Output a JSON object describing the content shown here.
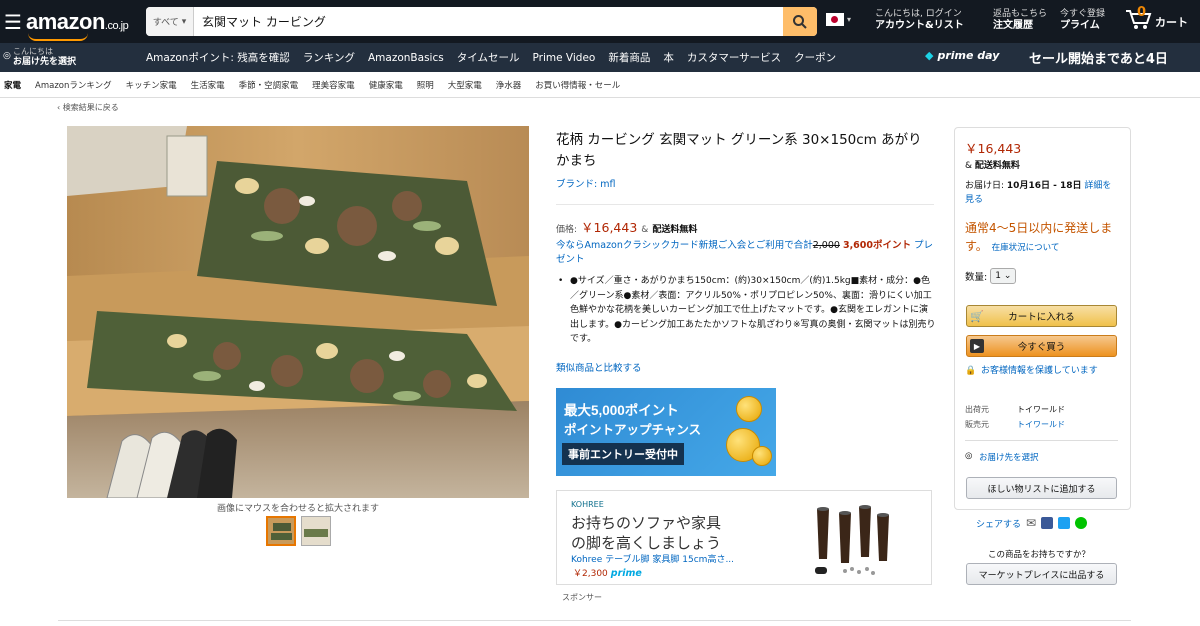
{
  "header": {
    "logo": "amazon",
    "logo_suffix": ".co.jp",
    "search_category": "すべて",
    "search_value": "玄関マット カービング",
    "greeting_l1": "こんにちは, ログイン",
    "greeting_l2": "アカウント&リスト",
    "orders_l1": "返品もこちら",
    "orders_l2": "注文履歴",
    "prime_l1": "今すぐ登録",
    "prime_l2": "プライム",
    "cart_count": "0",
    "cart_label": "カート"
  },
  "nav": {
    "deliver_l1": "こんにちは",
    "deliver_l2": "お届け先を選択",
    "links": [
      "Amazonポイント: 残高を確認",
      "ランキング",
      "AmazonBasics",
      "タイムセール",
      "Prime Video",
      "新着商品",
      "本",
      "カスタマーサービス",
      "クーポン"
    ],
    "prime_day": "prime day",
    "sale_banner": "セール開始まであと4日"
  },
  "subnav": [
    "家電",
    "Amazonランキング",
    "キッチン家電",
    "生活家電",
    "季節・空調家電",
    "理美容家電",
    "健康家電",
    "照明",
    "大型家電",
    "浄水器",
    "お買い得情報・セール"
  ],
  "breadcrumb": "‹ 検索結果に戻る",
  "gallery": {
    "hover_text": "画像にマウスを合わせると拡大されます"
  },
  "product": {
    "title": "花柄 カービング 玄関マット グリーン系 30×150cm あがりかまち",
    "brand": "ブランド: mfl",
    "price_label": "価格:",
    "price": "￥16,443",
    "free_ship_prefix": "&",
    "free_ship": "配送料無料",
    "promo_text": "今ならAmazonクラシックカード新規ご入会とご利用で合計",
    "promo_old": "2,000",
    "promo_points": "3,600ポイント",
    "promo_end": "プレゼント",
    "bullet": "●サイズ／重さ・あがりかまち150cm：(約)30×150cm／(約)1.5kg■素材・成分：●色／グリーン系●素材／表面：アクリル50%・ポリプロピレン50%、裏面：滑りにくい加工色鮮やかな花柄を美しいカービング加工で仕上げたマットです。●玄関をエレガントに演出します。●カービング加工あたたかソフトな肌ざわり※写真の奥側・玄関マットは別売りです。",
    "compare": "類似商品と比較する"
  },
  "banner": {
    "line1": "最大5,000ポイント",
    "line2": "ポイントアップチャンス",
    "line3": "事前エントリー受付中"
  },
  "ad": {
    "brand": "KOHREE",
    "headline1": "お持ちのソファや家具",
    "headline2": "の脚を高くしましょう",
    "product": "Kohree テーブル脚 家具脚 15cm高さ...",
    "price": "￥2,300",
    "prime": "prime",
    "sponsor": "スポンサー"
  },
  "buybox": {
    "price": "￥16,443",
    "ship_prefix": "&",
    "ship": "配送料無料",
    "date_prefix": "お届け日:",
    "date": "10月16日 - 18日",
    "date_link": "詳細を見る",
    "stock": "通常4～5日以内に発送します。",
    "stock_link": "在庫状況について",
    "qty_label": "数量:",
    "qty_value": "1",
    "add_to_cart": "カートに入れる",
    "buy_now": "今すぐ買う",
    "secure": "お客様情報を保護しています",
    "shipper_label": "出荷元",
    "shipper": "トイワールド",
    "seller_label": "販売元",
    "seller": "トイワールド",
    "address": "お届け先を選択",
    "wishlist": "ほしい物リストに追加する",
    "share": "シェアする",
    "own_question": "この商品をお持ちですか？",
    "sell_button": "マーケットプレイスに出品する"
  },
  "colors": {
    "header_bg": "#131921",
    "nav_bg": "#232f3e",
    "price": "#b12704",
    "link": "#0066c0",
    "stock": "#c45500",
    "search_button": "#febd69"
  }
}
